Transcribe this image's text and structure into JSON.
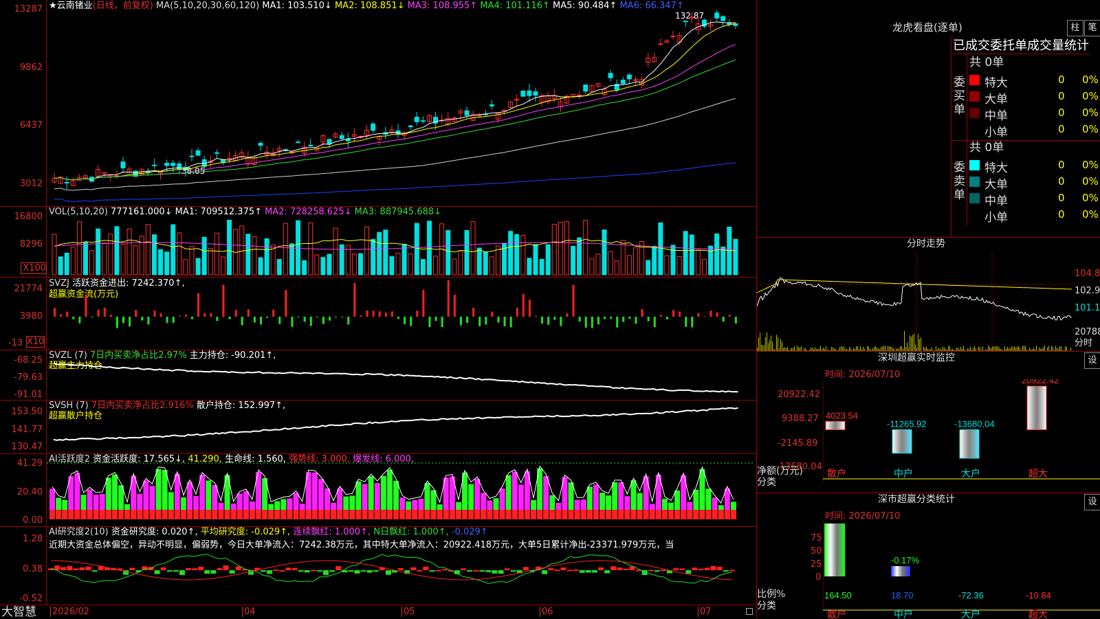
{
  "stock": {
    "name": "云南锗业",
    "mode": "(日线，前复权)",
    "ma_label": "MA(5,10,20,30,60,120)",
    "ma": [
      {
        "label": "MA1: 103.510↓",
        "color": "#ffffff"
      },
      {
        "label": "MA2: 108.851↓",
        "color": "#ffff00"
      },
      {
        "label": "MA3: 108.955↑",
        "color": "#ff40ff"
      },
      {
        "label": "MA4: 101.116↑",
        "color": "#30e030"
      },
      {
        "label": "MA5: 90.484↑",
        "color": "#ffffff"
      },
      {
        "label": "MA6: 66.347↑",
        "color": "#4060ff"
      }
    ],
    "price_axis": [
      "13287",
      "9862",
      "6437",
      "3012"
    ],
    "high_marker": "132.87",
    "low_marker": "38.85"
  },
  "vol": {
    "header": "VOL(5,10,20)",
    "value": "777161.000↓",
    "ma1": "MA1: 709512.375↑",
    "ma2": "MA2: 728258.625↓",
    "ma3": "MA3: 887945.688↓",
    "axis": [
      "16800",
      "8296",
      "X100"
    ]
  },
  "svzj": {
    "header": "SVZJ",
    "text": "活跃资金进出: 7242.370↑,",
    "subtitle": "超赢资金流(万元)",
    "axis": [
      "21774",
      "3980",
      "-13",
      "X10"
    ]
  },
  "svzl": {
    "header": "SVZL (7)",
    "text1": "7日内买卖净占比2.97%",
    "text2": "主力持仓: -90.201↑,",
    "subtitle": "超赢主力持仓",
    "axis": [
      "-68.25",
      "-79.63",
      "-91.01"
    ]
  },
  "svsh": {
    "header": "SVSH (7)",
    "text1": "7日内买卖净占比2.916%",
    "text2": "散户持仓: 152.997↑,",
    "subtitle": "超赢散户持仓",
    "axis": [
      "153.50",
      "141.77",
      "130.47"
    ]
  },
  "ai1": {
    "header": "AI活跃度2",
    "text": "资金活跃度: 17.565↓,",
    "v2": "41.290,",
    "life": "生命线: 1.560,",
    "strong": "强势线: 3.000,",
    "burst": "爆发线: 6.000,",
    "axis": [
      "41.29",
      "20.40",
      "0.00"
    ]
  },
  "ai2": {
    "header": "AI研究度2(10)",
    "text": "资金研究度: 0.020↑,",
    "avg": "平均研究度: -0.029↑,",
    "lian": "连续飘红: 1.000↑,",
    "n": "N日飘红: 1.000↑,",
    "last": "-0.029↑",
    "desc": "近期大资金总体偏空，异动不明显，偏弱势，今日大单净流入：7242.38万元，其中特大单净流入：20922.418万元，大单5日累计净出-23371.979万元，当",
    "axis": [
      "1.28",
      "0.38",
      "-0.52"
    ]
  },
  "xaxis": [
    "2026/02",
    "04",
    "05",
    "06",
    "07"
  ],
  "brand": "大智慧",
  "lhb": {
    "title": "龙虎看盘(逐单)",
    "btn1": "柱",
    "btn2": "笔",
    "tabs": "已成交委托单成交量统计",
    "buy": {
      "side": "委买单",
      "total": "共 0单",
      "rows": [
        {
          "label": "特大",
          "count": "0",
          "pct": "0%",
          "color": "#ff0000"
        },
        {
          "label": "大单",
          "count": "0",
          "pct": "0%",
          "color": "#900000"
        },
        {
          "label": "中单",
          "count": "0",
          "pct": "0%",
          "color": "#600000"
        },
        {
          "label": "小单",
          "count": "0",
          "pct": "0%",
          "color": "#000000"
        }
      ]
    },
    "sell": {
      "side": "委卖单",
      "total": "共 0单",
      "rows": [
        {
          "label": "特大",
          "count": "0",
          "pct": "0%",
          "color": "#00ffff"
        },
        {
          "label": "大单",
          "count": "0",
          "pct": "0%",
          "color": "#008080"
        },
        {
          "label": "中单",
          "count": "0",
          "pct": "0%",
          "color": "#006666"
        },
        {
          "label": "小单",
          "count": "0",
          "pct": "0%",
          "color": "#000000"
        }
      ]
    }
  },
  "fenshi": {
    "title": "分时走势",
    "axis": [
      "104.8",
      "102.9",
      "101.1",
      "20788",
      "分时"
    ]
  },
  "monitor": {
    "title": "深圳超赢实时监控",
    "btn": "设",
    "time": "时间: 2026/07/10",
    "axis": [
      "20922.42",
      "9388.27",
      "-2145.89",
      "-13680.04"
    ],
    "values": [
      "4023.54",
      "-11265.92",
      "-13680.04",
      "20922.42"
    ],
    "ylabel": "净额(万元)",
    "xtitle": "分类",
    "cats": [
      "散户",
      "中户",
      "大户",
      "超大"
    ]
  },
  "stats": {
    "title": "深市超赢分类统计",
    "btn": "设",
    "time": "时间: 2026/07/10",
    "axis": [
      "75",
      "50",
      "25",
      "0"
    ],
    "bar_label": "-0.17%",
    "ylabel": "比例%",
    "xtitle": "分类",
    "values": [
      "164.50",
      "18.70",
      "-72.36",
      "-10.84"
    ],
    "cats": [
      "散户",
      "中户",
      "大户",
      "超大"
    ]
  }
}
